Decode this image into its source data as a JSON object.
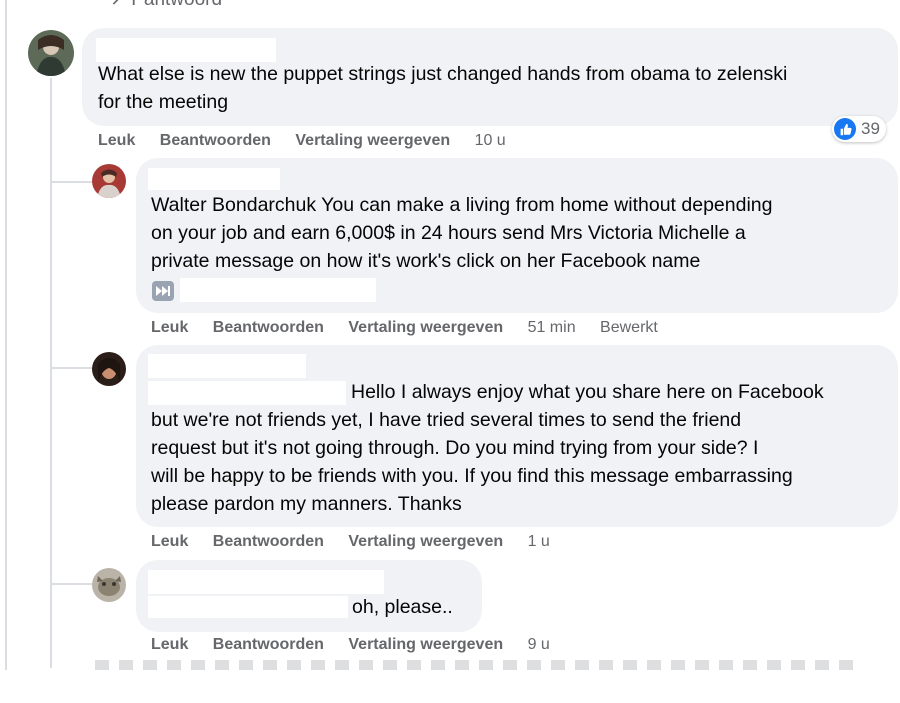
{
  "header": {
    "partial_reply_link": "↗ Pantwoord"
  },
  "labels": {
    "like": "Leuk",
    "reply": "Beantwoorden",
    "translate": "Vertaling weergeven"
  },
  "comments": [
    {
      "text": "What else is new the puppet strings just changed hands from obama to zelenski\nfor the meeting",
      "time": "10 u",
      "reaction_count": "39"
    },
    {
      "text": "Walter Bondarchuk You can make a living from home without depending\non your job and earn 6,000$ in 24 hours send Mrs Victoria Michelle a\nprivate message on how it's work's click on her Facebook name",
      "time": "51 min",
      "edited": "Bewerkt"
    },
    {
      "text_first": "Hello I always enjoy what you share here on Facebook",
      "text_rest": "but we're not friends yet, I have tried several times to send the friend\nrequest but it's not going through. Do you mind trying from your side? I\nwill be happy to be friends with you. If you find this message embarrassing\nplease pardon my manners. Thanks",
      "time": "1 u"
    },
    {
      "text": "oh, please..",
      "time": "9 u"
    }
  ],
  "colors": {
    "bubble": "#f0f2f5",
    "meta": "#65676b",
    "like_blue": "#1877f2",
    "text": "#050505"
  }
}
